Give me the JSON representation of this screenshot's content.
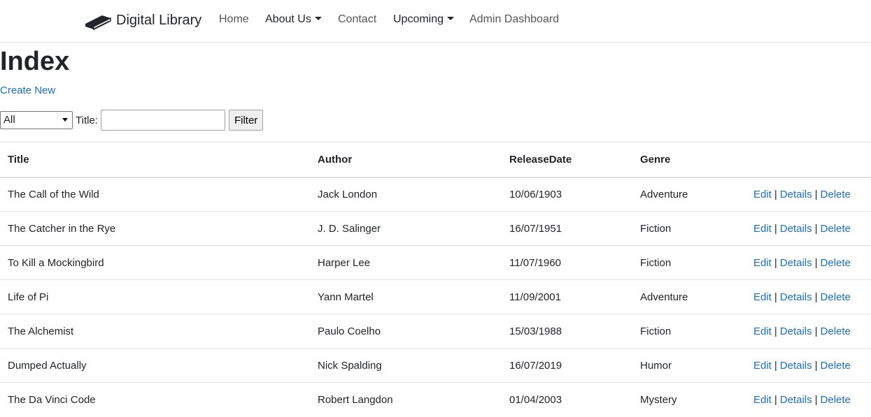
{
  "navbar": {
    "brand": "Digital Library",
    "links": {
      "home": "Home",
      "about": "About Us",
      "contact": "Contact",
      "upcoming": "Upcoming",
      "admin": "Admin Dashboard"
    }
  },
  "page": {
    "title": "Index",
    "create_new": "Create New"
  },
  "filter": {
    "genre_selected": "All",
    "title_label": "Title:",
    "title_value": "",
    "button": "Filter"
  },
  "table": {
    "headers": [
      "Title",
      "Author",
      "ReleaseDate",
      "Genre"
    ],
    "action_labels": {
      "edit": "Edit",
      "details": "Details",
      "delete": "Delete",
      "separator": "|"
    },
    "rows": [
      {
        "title": "The Call of the Wild",
        "author": "Jack London",
        "release_date": "10/06/1903",
        "genre": "Adventure"
      },
      {
        "title": "The Catcher in the Rye",
        "author": "J. D. Salinger",
        "release_date": "16/07/1951",
        "genre": "Fiction"
      },
      {
        "title": "To Kill a Mockingbird",
        "author": "Harper Lee",
        "release_date": "11/07/1960",
        "genre": "Fiction"
      },
      {
        "title": "Life of Pi",
        "author": "Yann Martel",
        "release_date": "11/09/2001",
        "genre": "Adventure"
      },
      {
        "title": "The Alchemist",
        "author": "Paulo Coelho",
        "release_date": "15/03/1988",
        "genre": "Fiction"
      },
      {
        "title": "Dumped Actually",
        "author": "Nick Spalding",
        "release_date": "16/07/2019",
        "genre": "Humor"
      },
      {
        "title": "The Da Vinci Code",
        "author": "Robert Langdon",
        "release_date": "01/04/2003",
        "genre": "Mystery"
      }
    ]
  },
  "colors": {
    "link": "#1b6ec2",
    "text": "#212529",
    "border": "#dee2e6"
  }
}
